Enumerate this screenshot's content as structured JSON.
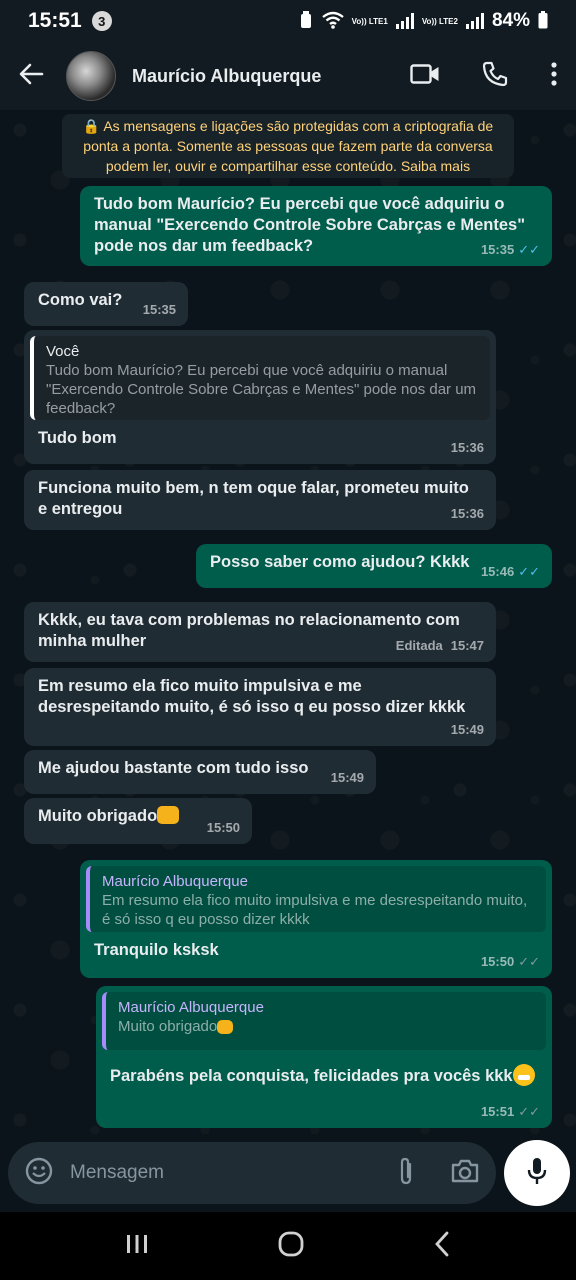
{
  "status": {
    "time": "15:51",
    "notif_count": "3",
    "lte1": "Vo)) LTE1",
    "lte2": "Vo)) LTE2",
    "battery": "84%"
  },
  "header": {
    "contact_name": "Maurício Albuquerque",
    "icons": [
      "back-arrow-icon",
      "video-call-icon",
      "phone-icon",
      "more-vert-icon"
    ]
  },
  "notice": {
    "text": "🔒 As mensagens e ligações são protegidas com a criptografia de ponta a ponta. Somente as pessoas que fazem parte da conversa podem ler, ouvir e compartilhar esse conteúdo. Saiba mais"
  },
  "messages": [
    {
      "text": "Tudo bom Maurício? Eu percebi que você adquiriu o manual \"Exercendo Controle Sobre Cabrças e Mentes\" pode nos dar um feedback?",
      "time": "15:35",
      "ticks": "✓✓"
    },
    {
      "text": "Como vai?",
      "time": "15:35"
    },
    {
      "quote_name": "Você",
      "quote_text": "Tudo bom Maurício? Eu percebi que você adquiriu o manual \"Exercendo Controle Sobre Cabrças e Mentes\" pode nos dar um feedback?",
      "text": "Tudo bom",
      "time": "15:36"
    },
    {
      "text": "Funciona muito bem, n tem oque falar, prometeu muito e entregou",
      "time": "15:36"
    },
    {
      "text": "Posso saber como ajudou? Kkkk",
      "time": "15:46",
      "ticks": "✓✓"
    },
    {
      "text": "Kkkk, eu tava com problemas no relacionamento com minha mulher",
      "time": "15:47",
      "edited": "Editada"
    },
    {
      "text": "Em resumo ela fico muito impulsiva e me desrespeitando muito, é só isso q eu posso dizer kkkk",
      "time": "15:49"
    },
    {
      "text": "Me ajudou bastante com tudo isso",
      "time": "15:49"
    },
    {
      "text": "Muito obrigado",
      "time": "15:50"
    },
    {
      "quote_name": "Maurício Albuquerque",
      "quote_text": "Em resumo ela fico muito impulsiva e me desrespeitando muito, é só isso q eu posso dizer kkkk",
      "text": "Tranquilo ksksk",
      "time": "15:50",
      "ticks": "✓✓"
    },
    {
      "quote_name": "Maurício Albuquerque",
      "quote_text": "Muito obrigado",
      "text": "Parabéns pela conquista, felicidades pra vocês kkk",
      "time": "15:51",
      "ticks": "✓✓"
    }
  ],
  "input": {
    "placeholder": "Mensagem",
    "icons": [
      "emoji-icon",
      "attach-icon",
      "camera-icon",
      "mic-icon"
    ]
  },
  "colors": {
    "incoming_bubble": "#202c33",
    "outgoing_bubble": "#005c4b",
    "read_ticks": "#53bdeb",
    "sent_ticks": "#8696a0",
    "notice_text": "#ffd279"
  }
}
